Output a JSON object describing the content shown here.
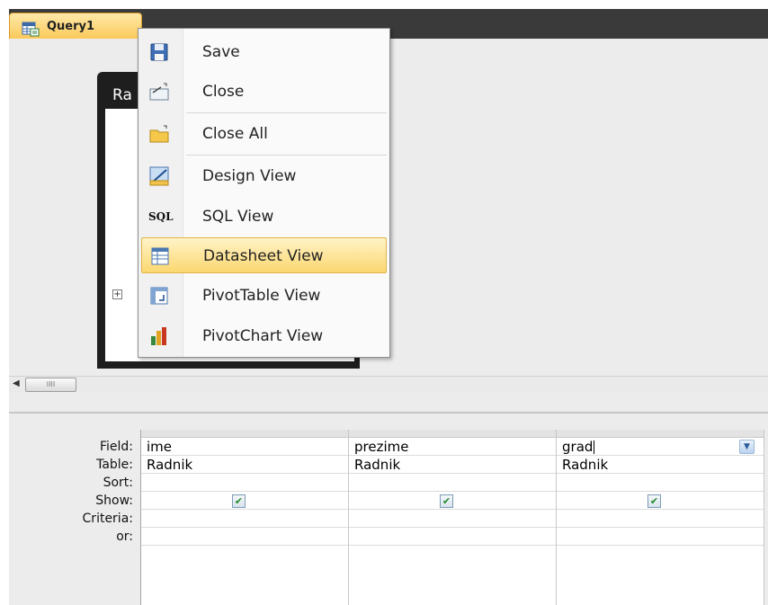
{
  "tab": {
    "label": "Query1"
  },
  "table_box": {
    "title": "Ra"
  },
  "context_menu": {
    "items": [
      {
        "label": "Save",
        "icon": "save-icon"
      },
      {
        "label": "Close",
        "icon": "close-icon"
      },
      {
        "label": "Close All",
        "icon": "close-all-icon"
      },
      {
        "label": "Design View",
        "icon": "design-view-icon"
      },
      {
        "label": "SQL View",
        "icon": "sql-view-icon",
        "icon_text": "SQL"
      },
      {
        "label": "Datasheet View",
        "icon": "datasheet-view-icon",
        "highlighted": true
      },
      {
        "label": "PivotTable View",
        "icon": "pivottable-view-icon"
      },
      {
        "label": "PivotChart View",
        "icon": "pivotchart-view-icon"
      }
    ]
  },
  "scrollbar": {
    "left_arrow": "◀",
    "thumb_grip": "IIII"
  },
  "qbe": {
    "row_labels": [
      "Field:",
      "Table:",
      "Sort:",
      "Show:",
      "Criteria:",
      "or:"
    ],
    "columns": [
      {
        "field": "ime",
        "table": "Radnik",
        "sort": "",
        "show": true,
        "criteria": "",
        "or": ""
      },
      {
        "field": "prezime",
        "table": "Radnik",
        "sort": "",
        "show": true,
        "criteria": "",
        "or": ""
      },
      {
        "field": "grad",
        "table": "Radnik",
        "sort": "",
        "show": true,
        "criteria": "",
        "or": ""
      }
    ],
    "check_glyph": "✔",
    "dropdown_glyph": "▼"
  },
  "colors": {
    "tab_bg": "#fbc550",
    "menu_highlight": "#fbd770",
    "checkmark": "#1f8a2b",
    "dark_bar": "#3a3a3a"
  }
}
